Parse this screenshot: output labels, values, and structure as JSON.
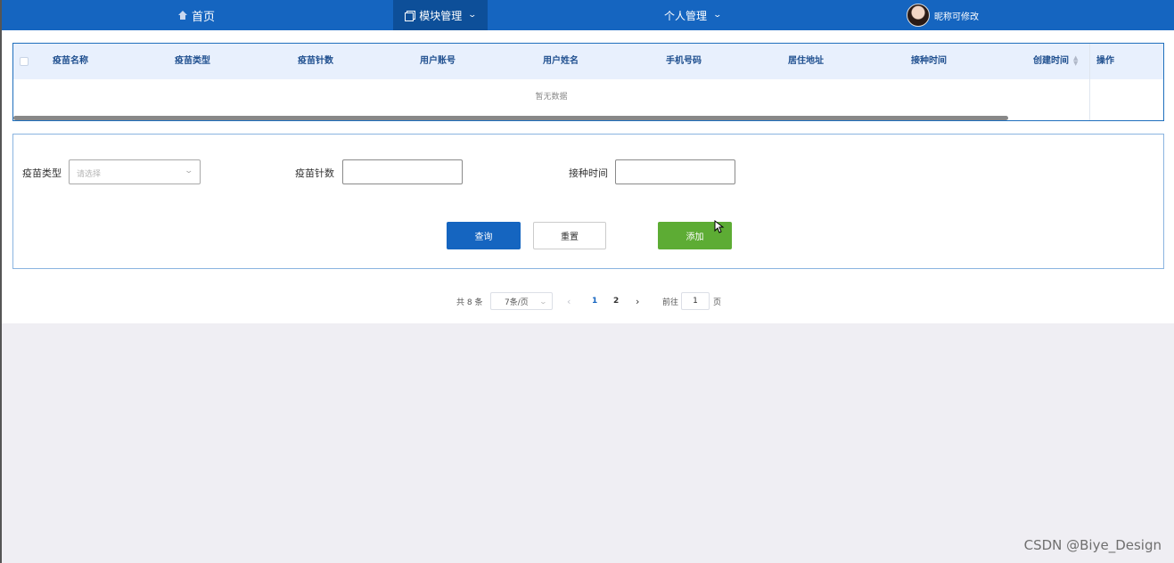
{
  "nav": {
    "home": "首页",
    "module": "模块管理",
    "personal": "个人管理",
    "nickname": "昵称可修改"
  },
  "table": {
    "columns": [
      "疫苗名称",
      "疫苗类型",
      "疫苗针数",
      "用户账号",
      "用户姓名",
      "手机号码",
      "居住地址",
      "接种时间",
      "创建时间"
    ],
    "operation": "操作",
    "empty_text": "暂无数据"
  },
  "form": {
    "vaccine_type_label": "疫苗类型",
    "vaccine_type_placeholder": "请选择",
    "dose_count_label": "疫苗针数",
    "vaccination_time_label": "接种时间",
    "query_label": "查询",
    "reset_label": "重置",
    "add_label": "添加"
  },
  "pagination": {
    "total": "共 8 条",
    "page_size": "7条/页",
    "pages": [
      "1",
      "2"
    ],
    "current_page": "1",
    "goto_label": "前往",
    "goto_value": "1",
    "page_suffix": "页"
  },
  "watermark": "CSDN @Biye_Design",
  "colors": {
    "nav_bg": "#1565c0",
    "nav_active_bg": "#0d4f99",
    "primary_button": "#1565c0",
    "add_button": "#5dac34",
    "page_bg": "#efeef3"
  },
  "icons": {
    "home": "home-icon",
    "module": "copy-icon",
    "dropdown": "chevron-down-icon",
    "sort": "sort-icon"
  }
}
